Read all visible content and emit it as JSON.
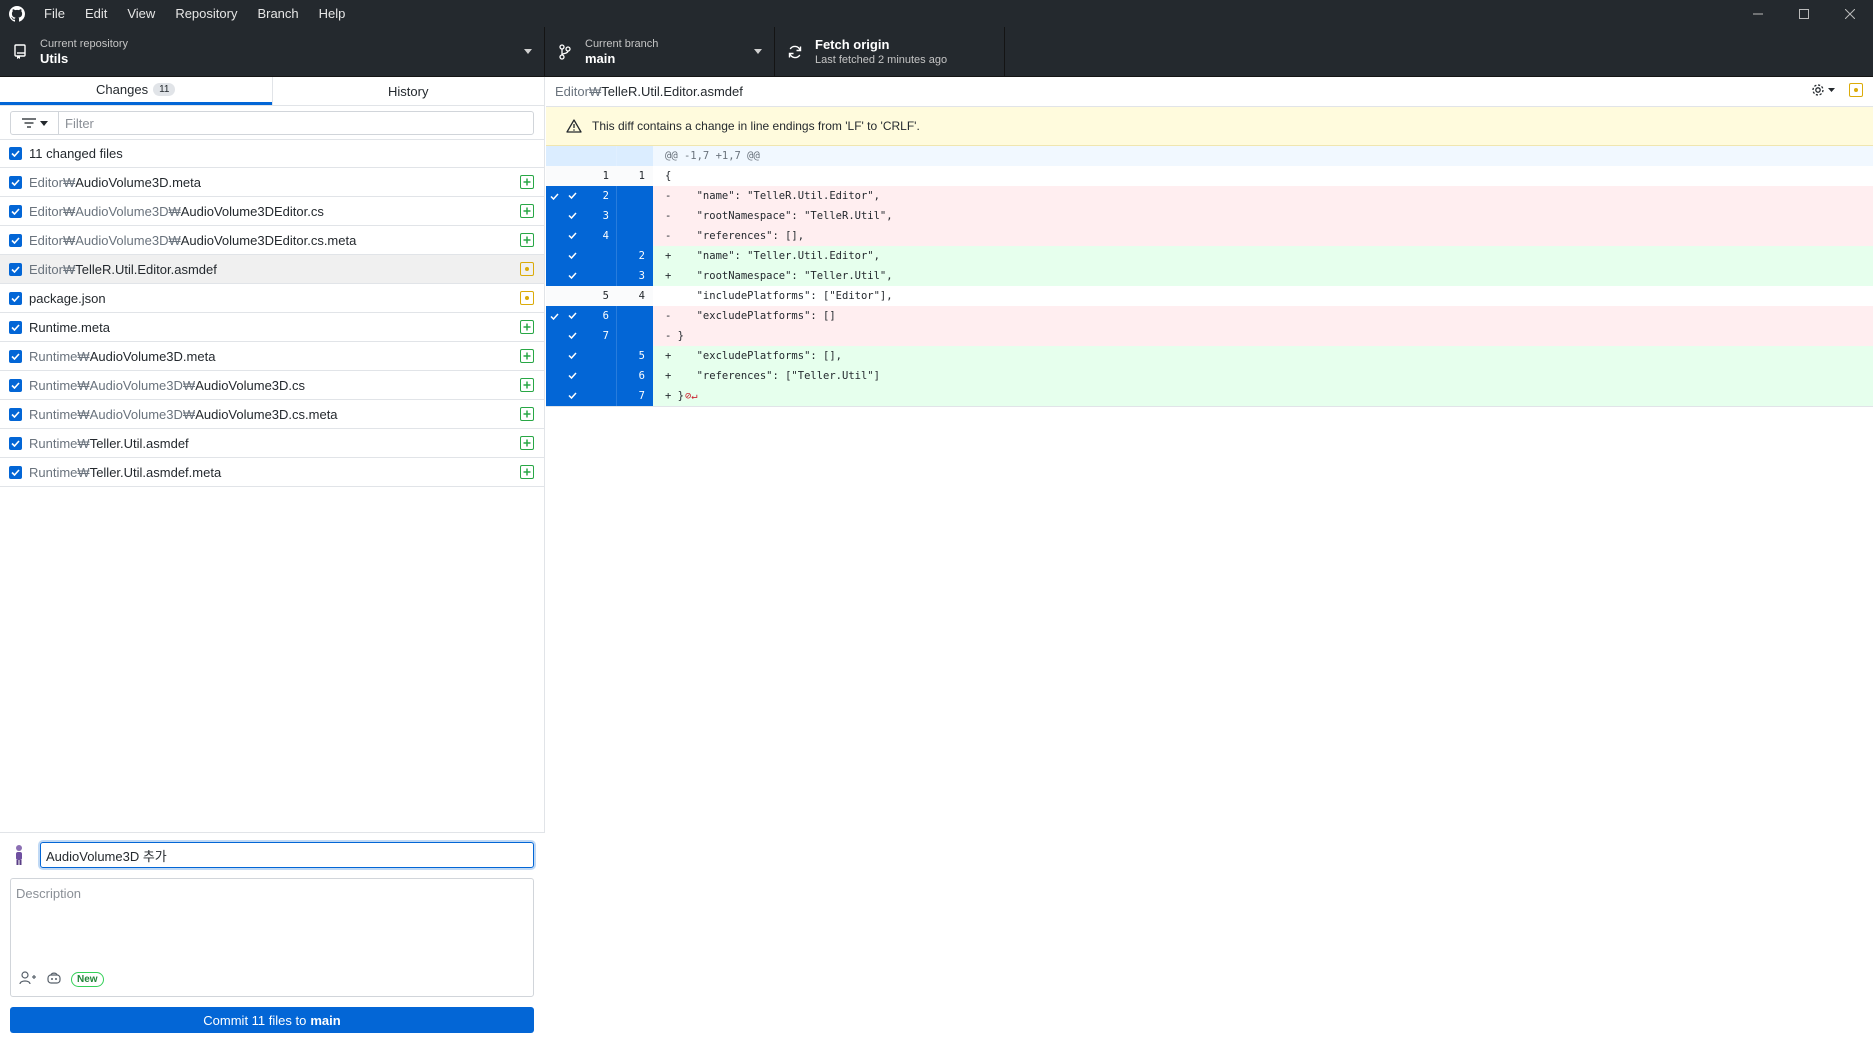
{
  "menu": [
    "File",
    "Edit",
    "View",
    "Repository",
    "Branch",
    "Help"
  ],
  "toolbar": {
    "repo_label": "Current repository",
    "repo_value": "Utils",
    "branch_label": "Current branch",
    "branch_value": "main",
    "fetch_label": "Fetch origin",
    "fetch_sub": "Last fetched 2 minutes ago"
  },
  "tabs": {
    "changes": "Changes",
    "changes_count": "11",
    "history": "History"
  },
  "filter": {
    "placeholder": "Filter"
  },
  "changed_files_label": "11 changed files",
  "files": [
    {
      "dir": "Editor₩",
      "name": "AudioVolume3D.meta",
      "status": "added"
    },
    {
      "dir": "Editor₩AudioVolume3D₩",
      "name": "AudioVolume3DEditor.cs",
      "status": "added"
    },
    {
      "dir": "Editor₩AudioVolume3D₩",
      "name": "AudioVolume3DEditor.cs.meta",
      "status": "added"
    },
    {
      "dir": "Editor₩",
      "name": "TelleR.Util.Editor.asmdef",
      "status": "modified"
    },
    {
      "dir": "",
      "name": "package.json",
      "status": "modified"
    },
    {
      "dir": "",
      "name": "Runtime.meta",
      "status": "added"
    },
    {
      "dir": "Runtime₩",
      "name": "AudioVolume3D.meta",
      "status": "added"
    },
    {
      "dir": "Runtime₩AudioVolume3D₩",
      "name": "AudioVolume3D.cs",
      "status": "added"
    },
    {
      "dir": "Runtime₩AudioVolume3D₩",
      "name": "AudioVolume3D.cs.meta",
      "status": "added"
    },
    {
      "dir": "Runtime₩",
      "name": "Teller.Util.asmdef",
      "status": "added"
    },
    {
      "dir": "Runtime₩",
      "name": "Teller.Util.asmdef.meta",
      "status": "added"
    }
  ],
  "commit": {
    "summary": "AudioVolume3D 추가",
    "description_placeholder": "Description",
    "new_badge": "New",
    "button_prefix": "Commit 11 files to",
    "button_branch": "main"
  },
  "diff": {
    "path_dir": "Editor₩",
    "path_name": "TelleR.Util.Editor.asmdef",
    "warning": "This diff contains a change in line endings from 'LF' to 'CRLF'.",
    "lines": [
      {
        "type": "hunk",
        "old": "",
        "new": "",
        "sel": false,
        "text": "@@ -1,7 +1,7 @@"
      },
      {
        "type": "ctx",
        "old": "1",
        "new": "1",
        "sel": false,
        "text": "{"
      },
      {
        "type": "del",
        "old": "2",
        "new": "",
        "sel": true,
        "text": "-    \"name\": \"TelleR.Util.Editor\","
      },
      {
        "type": "del",
        "old": "3",
        "new": "",
        "sel": true,
        "text": "-    \"rootNamespace\": \"TelleR.Util\","
      },
      {
        "type": "del",
        "old": "4",
        "new": "",
        "sel": true,
        "text": "-    \"references\": [],"
      },
      {
        "type": "add",
        "old": "",
        "new": "2",
        "sel": true,
        "text": "+    \"name\": \"Teller.Util.Editor\","
      },
      {
        "type": "add",
        "old": "",
        "new": "3",
        "sel": true,
        "text": "+    \"rootNamespace\": \"Teller.Util\","
      },
      {
        "type": "ctx",
        "old": "5",
        "new": "4",
        "sel": false,
        "text": "     \"includePlatforms\": [\"Editor\"],"
      },
      {
        "type": "del",
        "old": "6",
        "new": "",
        "sel": true,
        "text": "-    \"excludePlatforms\": []"
      },
      {
        "type": "del",
        "old": "7",
        "new": "",
        "sel": true,
        "text": "- }"
      },
      {
        "type": "add",
        "old": "",
        "new": "5",
        "sel": true,
        "text": "+    \"excludePlatforms\": [],"
      },
      {
        "type": "add",
        "old": "",
        "new": "6",
        "sel": true,
        "text": "+    \"references\": [\"Teller.Util\"]"
      },
      {
        "type": "add",
        "old": "",
        "new": "7",
        "sel": true,
        "text": "+ }",
        "no_eol": true
      }
    ]
  },
  "colors": {
    "accent": "#0366d6",
    "added": "#28a745",
    "modified": "#dbab09",
    "titlebar": "#24292e"
  },
  "icons": {
    "repo": "repo-icon",
    "branch": "git-branch-icon",
    "fetch": "sync-icon",
    "warning": "alert-icon",
    "settings": "gear-icon"
  }
}
